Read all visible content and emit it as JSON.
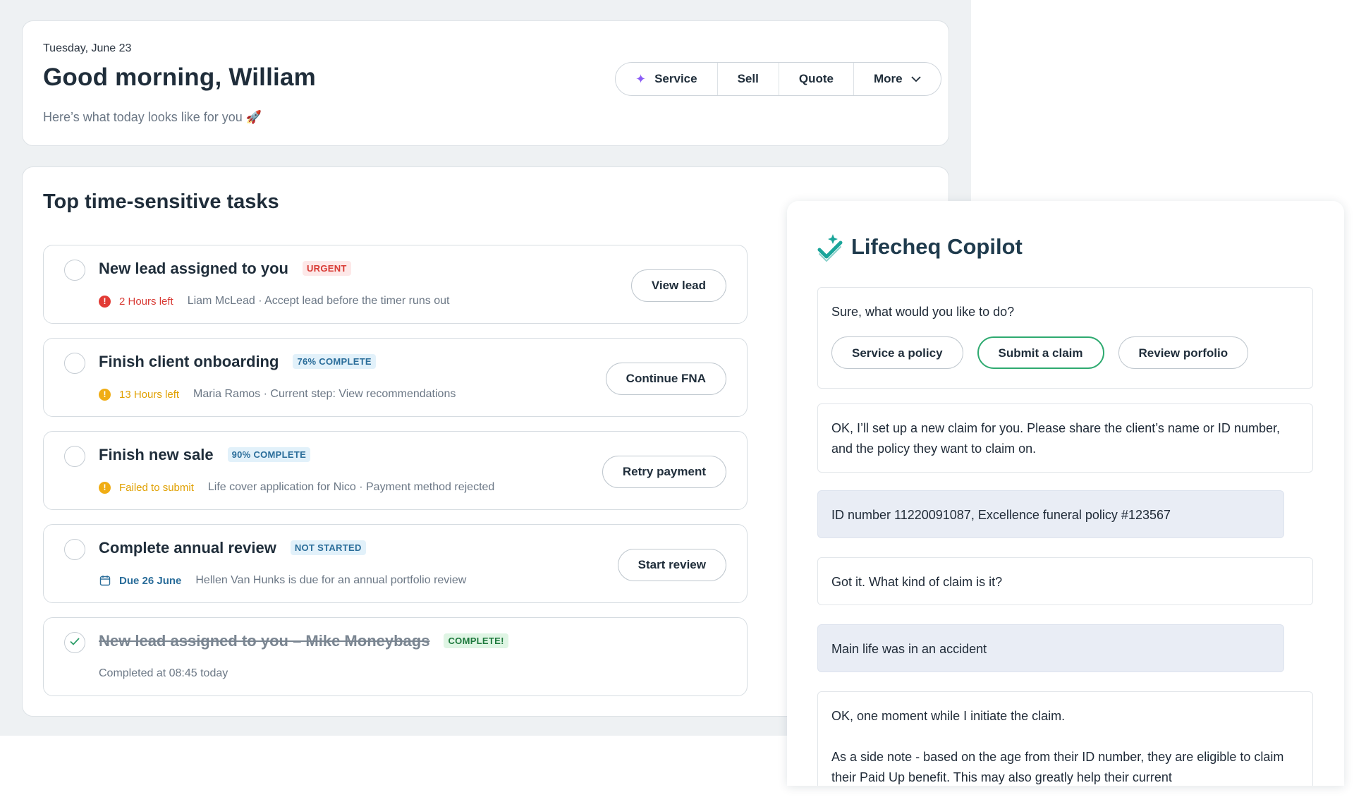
{
  "greeting": {
    "date": "Tuesday, June 23",
    "title": "Good morning, William",
    "subtitle": "Here’s what today looks like for you 🚀"
  },
  "actions": [
    {
      "label": "Service",
      "icon": "sparkle-icon"
    },
    {
      "label": "Sell"
    },
    {
      "label": "Quote"
    },
    {
      "label": "More",
      "icon": "chevron-down-icon"
    }
  ],
  "tasks": {
    "title": "Top time-sensitive tasks",
    "items": [
      {
        "title": "New lead assigned to you",
        "badge": "URGENT",
        "status": "2 Hours left",
        "detail": "Liam McLead · Accept lead before the timer runs out",
        "button": "View lead"
      },
      {
        "title": "Finish client onboarding",
        "badge": "76% COMPLETE",
        "status": "13 Hours left",
        "detail": "Maria Ramos · Current step: View recommendations",
        "button": "Continue FNA"
      },
      {
        "title": "Finish new sale",
        "badge": "90% COMPLETE",
        "status": "Failed to submit",
        "detail": "Life cover application for Nico · Payment method rejected",
        "button": "Retry payment"
      },
      {
        "title": "Complete annual review",
        "badge": "NOT STARTED",
        "status": "Due 26 June",
        "detail": "Hellen Van Hunks is due for an annual portfolio review",
        "button": "Start review"
      },
      {
        "title": "New lead assigned to you – Mike Moneybags",
        "badge": "COMPLETE!",
        "detail": "Completed at 08:45 today"
      }
    ]
  },
  "copilot": {
    "title": "Lifecheq Copilot",
    "messages": [
      {
        "text": "Sure, what would you like to do?",
        "chips": [
          "Service a policy",
          "Submit a claim",
          "Review porfolio"
        ]
      },
      {
        "text": "OK, I’ll set up a new claim for you. Please share the client’s name or ID number, and the policy they want to claim on."
      },
      {
        "text": "ID number 11220091087, Excellence funeral policy #123567"
      },
      {
        "text": "Got it. What kind of claim is it?"
      },
      {
        "text": "Main life was in an accident"
      },
      {
        "text": "OK, one moment while I initiate the claim.",
        "text2": "As a side note - based on the age from their ID number, they are eligible to claim their Paid Up benefit. This may also greatly help their current"
      }
    ]
  },
  "colors": {
    "accent_green": "#2eaa70",
    "urgent_red": "#d83a34",
    "warning_amber": "#f0ad14",
    "info_blue": "#2a6d9a",
    "brand_teal": "#1aa59a",
    "sparkle_purple": "#8b5cf6"
  }
}
